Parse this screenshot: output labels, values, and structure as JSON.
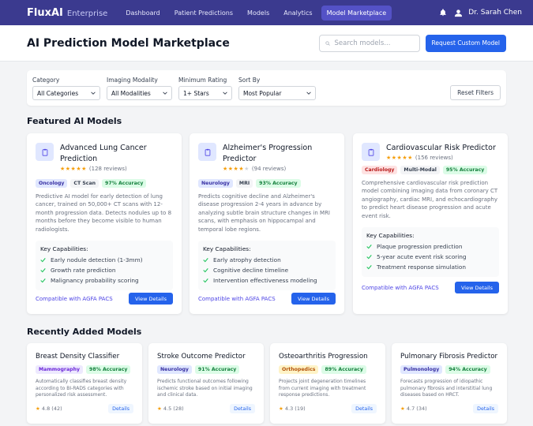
{
  "nav": {
    "brand": "FluxAI",
    "brand_sub": "Enterprise",
    "links": [
      "Dashboard",
      "Patient Predictions",
      "Models",
      "Analytics",
      "Model Marketplace"
    ],
    "active_index": 4,
    "user_name": "Dr. Sarah Chen"
  },
  "header": {
    "title": "AI Prediction Model Marketplace",
    "search_placeholder": "Search models...",
    "request_button": "Request Custom Model"
  },
  "filters": {
    "category": {
      "label": "Category",
      "value": "All Categories"
    },
    "modality": {
      "label": "Imaging Modality",
      "value": "All Modalities"
    },
    "rating": {
      "label": "Minimum Rating",
      "value": "1+ Stars"
    },
    "sort": {
      "label": "Sort By",
      "value": "Most Popular"
    },
    "reset_button": "Reset Filters"
  },
  "featured": {
    "title": "Featured AI Models",
    "cards": [
      {
        "title": "Advanced Lung Cancer Prediction",
        "stars": "★★★★★",
        "reviews": "(128 reviews)",
        "tags": [
          "Oncology",
          "CT Scan",
          "97% Accuracy"
        ],
        "description": "Predictive AI model for early detection of lung cancer, trained on 50,000+ CT scans with 12-month progression data. Detects nodules up to 8 months before they become visible to human radiologists.",
        "caps_title": "Key Capabilities:",
        "caps": [
          "Early nodule detection (1-3mm)",
          "Growth rate prediction",
          "Malignancy probability scoring"
        ],
        "compat": "Compatible with AGFA PACS",
        "button": "View Details"
      },
      {
        "title": "Alzheimer's Progression Predictor",
        "stars": "★★★★",
        "stars_empty": "★",
        "reviews": "(94 reviews)",
        "tags": [
          "Neurology",
          "MRI",
          "93% Accuracy"
        ],
        "description": "Predicts cognitive decline and Alzheimer's disease progression 2-4 years in advance by analyzing subtle brain structure changes in MRI scans, with emphasis on hippocampal and temporal lobe regions.",
        "caps_title": "Key Capabilities:",
        "caps": [
          "Early atrophy detection",
          "Cognitive decline timeline",
          "Intervention effectiveness modeling"
        ],
        "compat": "Compatible with AGFA PACS",
        "button": "View Details"
      },
      {
        "title": "Cardiovascular Risk Predictor",
        "stars": "★★★★★",
        "reviews": "(156 reviews)",
        "tags": [
          "Cardiology",
          "Multi-Modal",
          "95% Accuracy"
        ],
        "description": "Comprehensive cardiovascular risk prediction model combining imaging data from coronary CT angiography, cardiac MRI, and echocardiography to predict heart disease progression and acute event risk.",
        "caps_title": "Key Capabilities:",
        "caps": [
          "Plaque progression prediction",
          "5-year acute event risk scoring",
          "Treatment response simulation"
        ],
        "compat": "Compatible with AGFA PACS",
        "button": "View Details"
      }
    ]
  },
  "recent": {
    "title": "Recently Added Models",
    "cards": [
      {
        "title": "Breast Density Classifier",
        "tags": [
          "Mammography",
          "98% Accuracy"
        ],
        "description": "Automatically classifies breast density according to BI-RADS categories with personalized risk assessment.",
        "rating": "4.8 (42)",
        "button": "Details"
      },
      {
        "title": "Stroke Outcome Predictor",
        "tags": [
          "Neurology",
          "91% Accuracy"
        ],
        "description": "Predicts functional outcomes following ischemic stroke based on initial imaging and clinical data.",
        "rating": "4.5 (28)",
        "button": "Details"
      },
      {
        "title": "Osteoarthritis Progression",
        "tags": [
          "Orthopedics",
          "89% Accuracy"
        ],
        "description": "Projects joint degeneration timelines from current imaging with treatment response predictions.",
        "rating": "4.3 (19)",
        "button": "Details"
      },
      {
        "title": "Pulmonary Fibrosis Predictor",
        "tags": [
          "Pulmonology",
          "94% Accuracy"
        ],
        "description": "Forecasts progression of idiopathic pulmonary fibrosis and interstitial lung diseases based on HRCT.",
        "rating": "4.7 (34)",
        "button": "Details"
      }
    ]
  },
  "colors": {
    "nav_bg": "#3b3a8f",
    "primary": "#2563eb",
    "star": "#f59e0b",
    "success": "#22c55e"
  },
  "icons": [
    "bell-icon",
    "user-icon",
    "search-icon",
    "clipboard-icon",
    "check-icon",
    "chevron-down-icon"
  ]
}
